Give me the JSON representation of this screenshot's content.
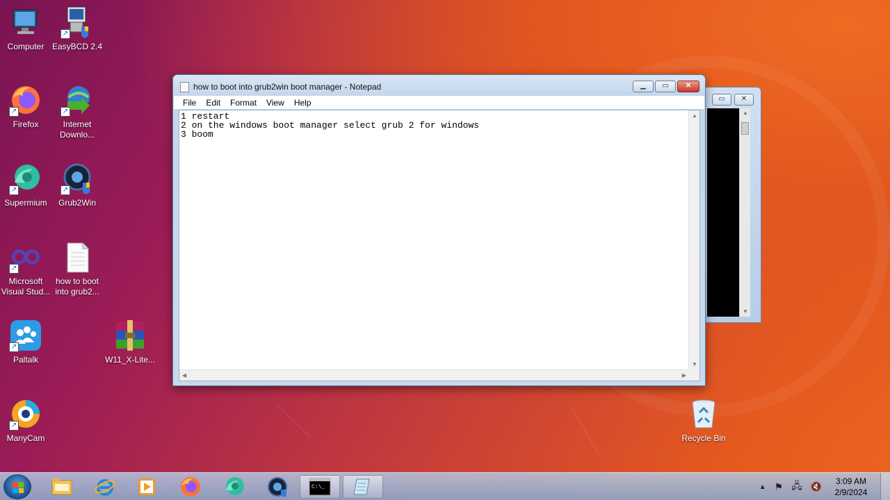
{
  "desktop": {
    "icons": [
      {
        "label": "Computer"
      },
      {
        "label": "EasyBCD 2.4"
      },
      {
        "label": "Firefox"
      },
      {
        "label": "Internet Downlo..."
      },
      {
        "label": "Supermium"
      },
      {
        "label": "Grub2Win"
      },
      {
        "label": "Microsoft Visual Stud..."
      },
      {
        "label": "how to boot into grub2..."
      },
      {
        "label": "Paltalk"
      },
      {
        "label": "W11_X-Lite..."
      },
      {
        "label": "ManyCam"
      },
      {
        "label": "Recycle Bin"
      }
    ]
  },
  "notepad": {
    "title": "how to boot into grub2win boot manager - Notepad",
    "menu": [
      "File",
      "Edit",
      "Format",
      "View",
      "Help"
    ],
    "content": "1 restart\n2 on the windows boot manager select grub 2 for windows\n3 boom"
  },
  "taskbar": {
    "items": [
      "file-explorer",
      "internet-explorer",
      "media-player",
      "firefox",
      "supermium",
      "grub2win",
      "command-prompt",
      "notepad"
    ],
    "clock_time": "3:09 AM",
    "clock_date": "2/9/2024"
  },
  "colors": {
    "wallpaper_left": "#7a1454",
    "wallpaper_right": "#ec6420",
    "close_button": "#c7362a"
  }
}
